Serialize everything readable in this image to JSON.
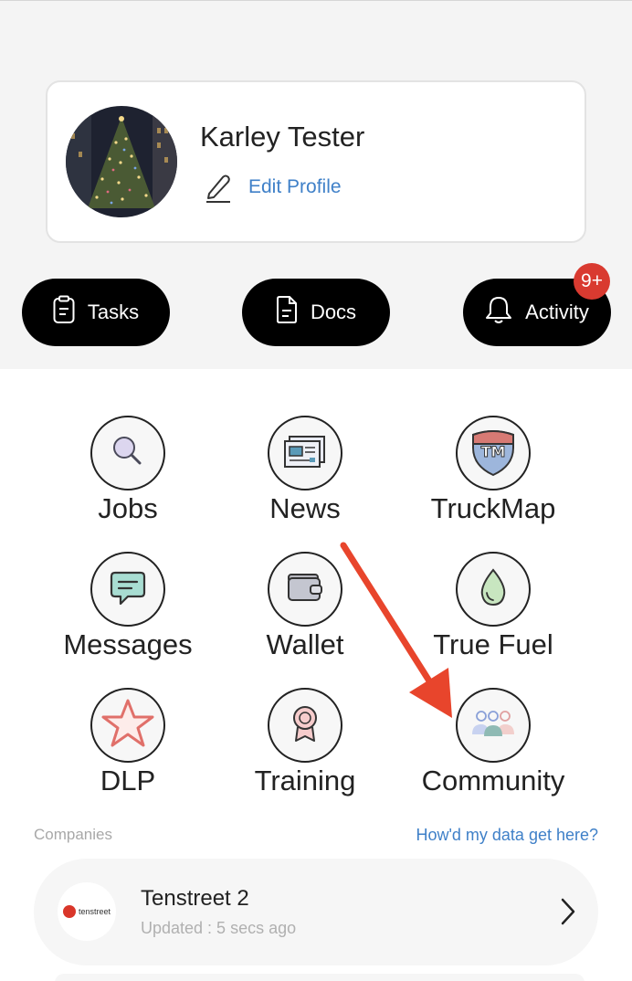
{
  "profile": {
    "name": "Karley Tester",
    "edit_label": "Edit Profile"
  },
  "quick_actions": [
    {
      "label": "Tasks",
      "icon": "clipboard-icon"
    },
    {
      "label": "Docs",
      "icon": "document-icon"
    },
    {
      "label": "Activity",
      "icon": "bell-icon",
      "badge": "9+"
    }
  ],
  "apps": [
    {
      "label": "Jobs",
      "icon": "magnifier-icon"
    },
    {
      "label": "News",
      "icon": "newspaper-icon"
    },
    {
      "label": "TruckMap",
      "icon": "truckmap-shield-icon"
    },
    {
      "label": "Messages",
      "icon": "chat-bubble-icon"
    },
    {
      "label": "Wallet",
      "icon": "wallet-icon"
    },
    {
      "label": "True Fuel",
      "icon": "fuel-drop-icon"
    },
    {
      "label": "DLP",
      "icon": "star-icon"
    },
    {
      "label": "Training",
      "icon": "award-ribbon-icon"
    },
    {
      "label": "Community",
      "icon": "people-group-icon"
    }
  ],
  "companies": {
    "section_label": "Companies",
    "help_link": "How'd my data get here?",
    "items": [
      {
        "name": "Tenstreet 2",
        "updated": "Updated : 5 secs ago",
        "logo_text": "tenstreet"
      }
    ]
  },
  "colors": {
    "accent_blue": "#3f80c8",
    "badge_red": "#d93a30",
    "annotation_arrow": "#e8452c"
  }
}
